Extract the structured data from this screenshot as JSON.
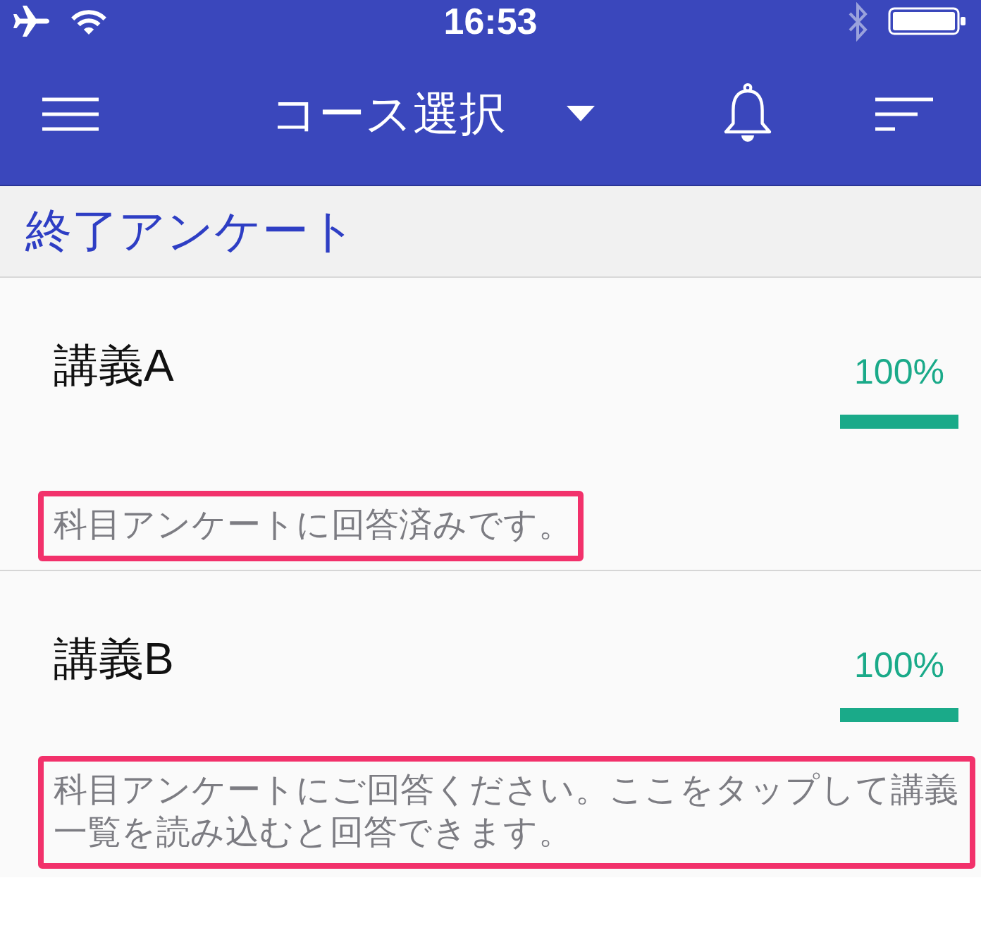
{
  "status_bar": {
    "time": "16:53"
  },
  "nav_bar": {
    "title": "コース選択"
  },
  "section": {
    "title": "終了アンケート"
  },
  "lectures": [
    {
      "name": "講義A",
      "percent": "100%",
      "level": 1,
      "note": "科目アンケートに回答済みです。",
      "highlighted": true
    },
    {
      "name": "講義B",
      "percent": "100%",
      "level": 1,
      "note": "科目アンケートにご回答ください。ここをタップして講義一覧を読み込むと回答できます。",
      "highlighted": true
    }
  ]
}
